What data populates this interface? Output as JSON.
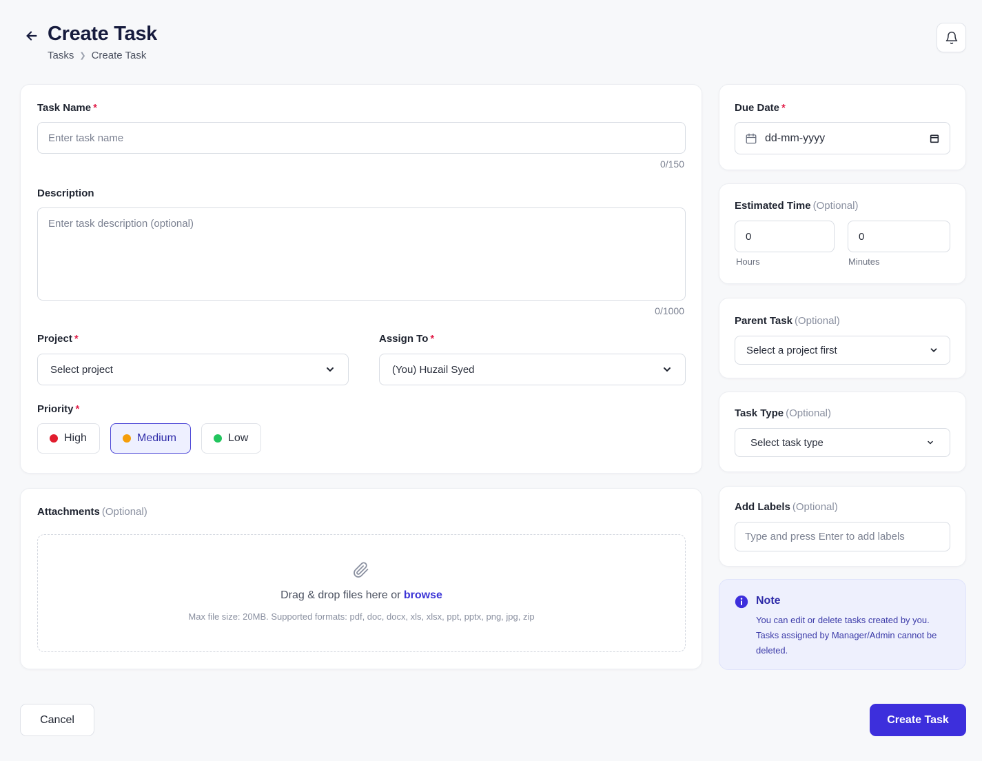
{
  "header": {
    "title": "Create Task",
    "breadcrumb": [
      "Tasks",
      "Create Task"
    ]
  },
  "task_name": {
    "label": "Task Name",
    "required": "*",
    "placeholder": "Enter task name",
    "counter": "0/150"
  },
  "description": {
    "label": "Description",
    "placeholder": "Enter task description (optional)",
    "counter": "0/1000"
  },
  "project": {
    "label": "Project",
    "required": "*",
    "value": "Select project"
  },
  "assign_to": {
    "label": "Assign To",
    "required": "*",
    "value": "(You) Huzail Syed"
  },
  "priority": {
    "label": "Priority",
    "required": "*",
    "options": [
      {
        "label": "High",
        "color": "#e11d2e"
      },
      {
        "label": "Medium",
        "color": "#f59e0b",
        "selected": true
      },
      {
        "label": "Low",
        "color": "#22c55e"
      }
    ]
  },
  "attachments": {
    "label": "Attachments",
    "optional": "(Optional)",
    "drop_text": "Drag & drop files here or",
    "browse": "browse",
    "hint": "Max file size: 20MB. Supported formats: pdf, doc, docx, xls, xlsx, ppt, pptx, png, jpg, zip"
  },
  "due_date": {
    "label": "Due Date",
    "required": "*",
    "placeholder": "dd-mm-yyyy"
  },
  "estimated_time": {
    "label": "Estimated Time",
    "optional": "(Optional)",
    "hours_value": "0",
    "minutes_value": "0",
    "hours_caption": "Hours",
    "minutes_caption": "Minutes"
  },
  "parent_task": {
    "label": "Parent Task",
    "optional": "(Optional)",
    "value": "Select a project first"
  },
  "task_type": {
    "label": "Task Type",
    "optional": "(Optional)",
    "value": "Select task type"
  },
  "labels": {
    "label": "Add Labels",
    "optional": "(Optional)",
    "placeholder": "Type and press Enter to add labels"
  },
  "note": {
    "title": "Note",
    "body": "You can edit or delete tasks created by you. Tasks assigned by Manager/Admin cannot be deleted."
  },
  "actions": {
    "cancel": "Cancel",
    "create": "Create Task"
  },
  "colors": {
    "accent": "#3d2fdc",
    "required": "#e11d48"
  }
}
